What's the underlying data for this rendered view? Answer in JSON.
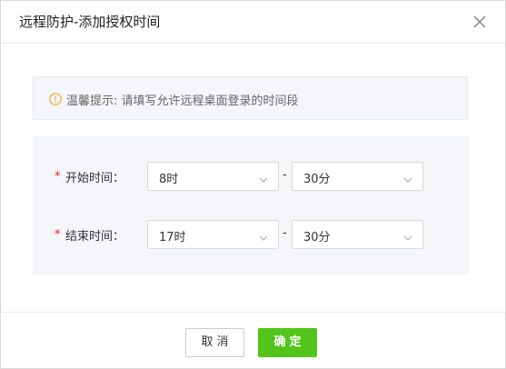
{
  "dialog": {
    "title": "远程防护-添加授权时间",
    "close_icon": "close-icon"
  },
  "tip": {
    "icon": "warning-circle-icon",
    "text": "温馨提示: 请填写允许远程桌面登录的时间段"
  },
  "form": {
    "required_mark": "*",
    "separator": "-",
    "start": {
      "label": "开始时间：",
      "hour": "8时",
      "minute": "30分"
    },
    "end": {
      "label": "结束时间：",
      "hour": "17时",
      "minute": "30分"
    }
  },
  "footer": {
    "cancel_label": "取消",
    "ok_label": "确定"
  },
  "colors": {
    "accent": "#52c41a",
    "required": "#e02020",
    "warning": "#f5a623"
  }
}
